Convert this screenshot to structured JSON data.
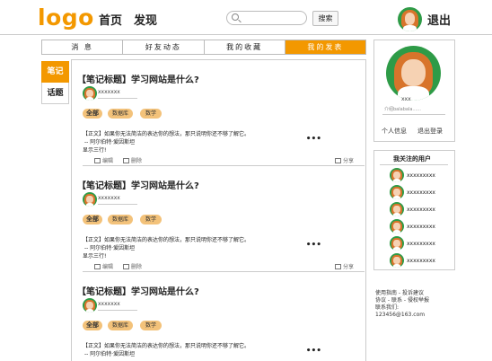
{
  "header": {
    "logo": "logo",
    "nav": [
      "首页",
      "发现"
    ],
    "search_button": "搜索",
    "logout": "退出"
  },
  "tabs": [
    "消 息",
    "好友动态",
    "我的收藏",
    "我的发表"
  ],
  "side_tabs": [
    "笔记",
    "话题"
  ],
  "posts": [
    {
      "title": "【笔记标题】学习网站是什么?",
      "user": "xxxxxxx",
      "tags": [
        "全部",
        "数据库",
        "数学"
      ],
      "body1": "【正文】如果你无法简洁的表达你的想法，那只说明你还不够了解它。",
      "body2": "-- 阿尔伯特·爱因斯坦",
      "more": "显示三行!",
      "dots": "•••",
      "edit": "编辑",
      "delete": "删除",
      "share": "分享"
    },
    {
      "title": "【笔记标题】学习网站是什么?",
      "user": "xxxxxxx",
      "tags": [
        "全部",
        "数据库",
        "数学"
      ],
      "body1": "【正文】如果你无法简洁的表达你的想法，那只说明你还不够了解它。",
      "body2": "-- 阿尔伯特·爱因斯坦",
      "more": "显示三行!",
      "dots": "•••",
      "edit": "编辑",
      "delete": "删除",
      "share": "分享"
    },
    {
      "title": "【笔记标题】学习网站是什么?",
      "user": "xxxxxxx",
      "tags": [
        "全部",
        "数据库",
        "数学"
      ],
      "body1": "【正文】如果你无法简洁的表达你的想法，那只说明你还不够了解它。",
      "body2": "-- 阿尔伯特·爱因斯坦",
      "dots": "•••"
    }
  ],
  "profile": {
    "name": "xxx",
    "intro": "介绍balabala......",
    "personal_info": "个人信息",
    "logout": "退出登录"
  },
  "following": {
    "title": "我关注的用户",
    "users": [
      "xxxxxxxxx",
      "xxxxxxxxx",
      "xxxxxxxxx",
      "xxxxxxxxx",
      "xxxxxxxxx",
      "xxxxxxxxx"
    ]
  },
  "footer": {
    "line1": "使用指南 - 投诉建议",
    "line2": "协议 - 联系 - 侵权举报",
    "line3": "联系我们:",
    "line4": "123456@163.com"
  }
}
